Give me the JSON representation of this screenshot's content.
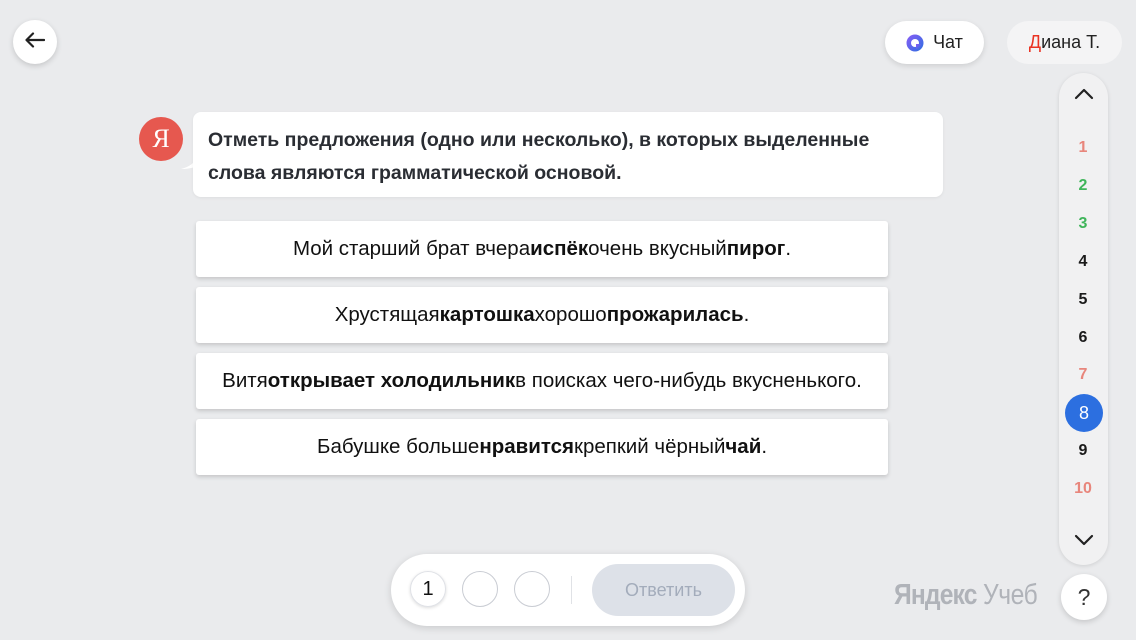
{
  "header": {
    "back_icon": "arrow-left-icon",
    "chat_label": "Чат",
    "chat_icon": "alice-chat-icon",
    "user_initial": "Д",
    "user_rest": "иана Т."
  },
  "question": {
    "avatar_letter": "Я",
    "line1": "Отметь предложения (одно или несколько), в которых выделенные",
    "line2": "слова являются грамматической основой."
  },
  "options": [
    {
      "parts": [
        {
          "t": "Мой старший брат вчера ",
          "b": false
        },
        {
          "t": "испёк",
          "b": true
        },
        {
          "t": " очень вкусный ",
          "b": false
        },
        {
          "t": "пирог",
          "b": true
        },
        {
          "t": ".",
          "b": false
        }
      ]
    },
    {
      "parts": [
        {
          "t": "Хрустящая ",
          "b": false
        },
        {
          "t": "картошка",
          "b": true
        },
        {
          "t": " хорошо ",
          "b": false
        },
        {
          "t": "прожарилась",
          "b": true
        },
        {
          "t": ".",
          "b": false
        }
      ]
    },
    {
      "parts": [
        {
          "t": "Витя ",
          "b": false
        },
        {
          "t": "открывает холодильник",
          "b": true
        },
        {
          "t": " в поисках чего-нибудь вкусненького.",
          "b": false
        }
      ]
    },
    {
      "parts": [
        {
          "t": "Бабушке больше ",
          "b": false
        },
        {
          "t": "нравится",
          "b": true
        },
        {
          "t": " крепкий чёрный ",
          "b": false
        },
        {
          "t": "чай",
          "b": true
        },
        {
          "t": ".",
          "b": false
        }
      ]
    }
  ],
  "navigator": {
    "up_icon": "chevron-up-icon",
    "down_icon": "chevron-down-icon",
    "current": "8",
    "items": [
      {
        "label": "1",
        "status": "wrong"
      },
      {
        "label": "2",
        "status": "correct"
      },
      {
        "label": "3",
        "status": "correct"
      },
      {
        "label": "4",
        "status": "default"
      },
      {
        "label": "5",
        "status": "default"
      },
      {
        "label": "6",
        "status": "default"
      },
      {
        "label": "7",
        "status": "wrong"
      },
      {
        "label": "8",
        "status": "current"
      },
      {
        "label": "9",
        "status": "default"
      },
      {
        "label": "10",
        "status": "wrong"
      }
    ]
  },
  "answer_bar": {
    "slots": [
      "1",
      "",
      ""
    ],
    "submit_label": "Ответить"
  },
  "footer": {
    "brand_strong": "Яндекс",
    "brand_light": " Учебник",
    "help_label": "?"
  },
  "colors": {
    "background": "#eaebed",
    "accent_blue": "#2c6fe0",
    "wrong": "#e8867c",
    "correct": "#3fb55a",
    "default": "#1a1a1a",
    "avatar_red": "#e6584f",
    "brand_red": "#ea3323"
  }
}
